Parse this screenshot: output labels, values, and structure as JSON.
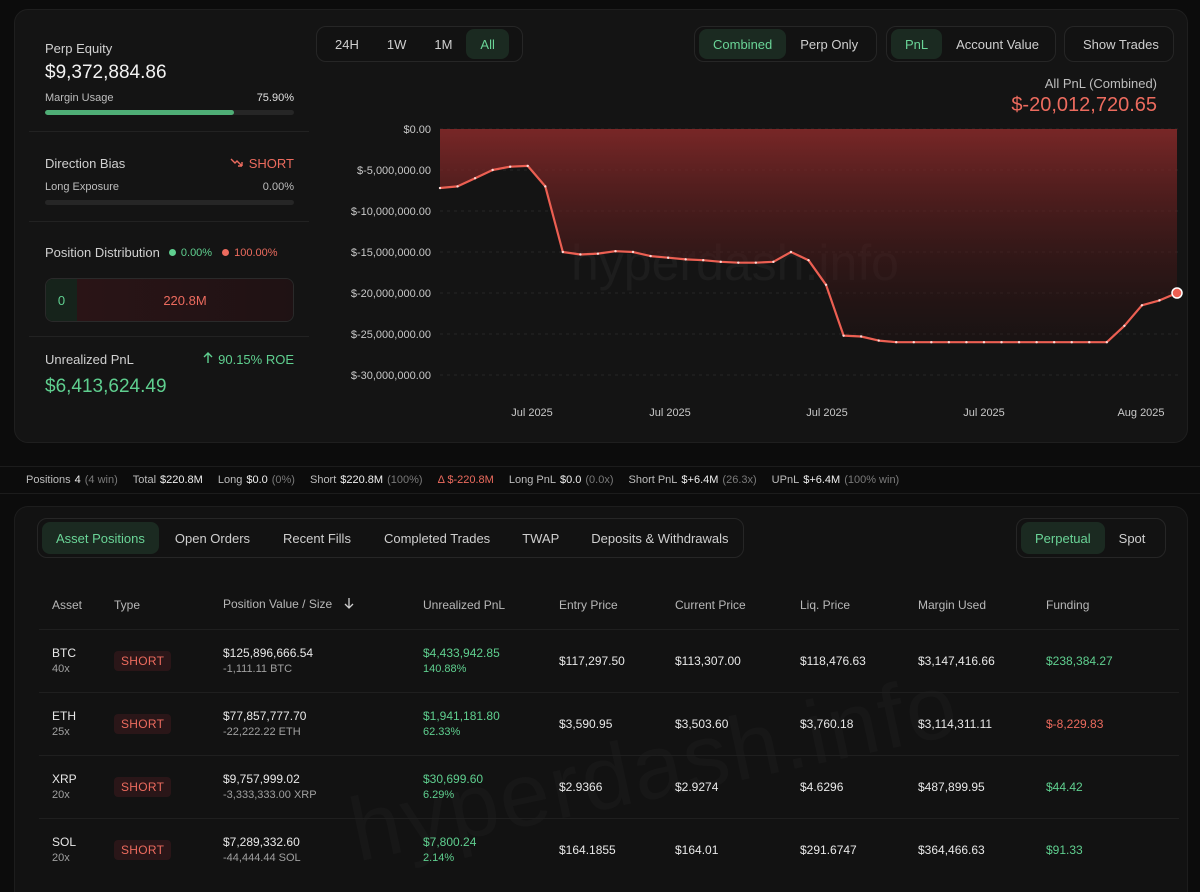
{
  "left": {
    "perp_equity_label": "Perp Equity",
    "perp_equity_value": "$9,372,884.86",
    "margin_usage_label": "Margin Usage",
    "margin_usage_value": "75.90%",
    "margin_usage_fraction": 0.759,
    "direction_bias_label": "Direction Bias",
    "direction_bias_value": "SHORT",
    "long_exposure_label": "Long Exposure",
    "long_exposure_value": "0.00%",
    "position_distribution_label": "Position Distribution",
    "dist_long_pct": "0.00%",
    "dist_short_pct": "100.00%",
    "dist_long_value": "0",
    "dist_short_value": "220.8M",
    "unrealized_pnl_label": "Unrealized PnL",
    "roe_value": "90.15% ROE",
    "unrealized_pnl_value": "$6,413,624.49"
  },
  "controls": {
    "time_ranges": [
      "24H",
      "1W",
      "1M",
      "All"
    ],
    "time_active": "All",
    "mode_options": [
      "Combined",
      "Perp Only"
    ],
    "mode_active": "Combined",
    "metric_options": [
      "PnL",
      "Account Value"
    ],
    "metric_active": "PnL",
    "show_trades_label": "Show Trades"
  },
  "chart_header": {
    "title": "All PnL (Combined)",
    "value": "$-20,012,720.65"
  },
  "watermark": "hyperdash.info",
  "chart_data": {
    "type": "area",
    "y_ticks": [
      "$0.00",
      "$-5,000,000.00",
      "$-10,000,000.00",
      "$-15,000,000.00",
      "$-20,000,000.00",
      "$-25,000,000.00",
      "$-30,000,000.00"
    ],
    "x_ticks": [
      "Jul 2025",
      "Jul 2025",
      "Jul 2025",
      "Jul 2025",
      "Aug 2025"
    ],
    "ylim": [
      -30000000,
      0
    ],
    "series": [
      {
        "values": [
          -7200000,
          -7000000,
          -6000000,
          -5000000,
          -4600000,
          -4500000,
          -7000000,
          -15000000,
          -15300000,
          -15200000,
          -14900000,
          -15000000,
          -15500000,
          -15700000,
          -15900000,
          -16000000,
          -16200000,
          -16300000,
          -16300000,
          -16200000,
          -15000000,
          -16000000,
          -19000000,
          -25200000,
          -25300000,
          -25800000,
          -26000000,
          -26000000,
          -26000000,
          -26000000,
          -26000000,
          -26000000,
          -26000000,
          -26000000,
          -26000000,
          -26000000,
          -26000000,
          -26000000,
          -26000000,
          -24000000,
          -21500000,
          -20900000,
          -20000000
        ]
      }
    ],
    "grid": true,
    "color": "#ec5f52"
  },
  "summary": {
    "positions_label": "Positions",
    "positions_value": "4",
    "positions_note": "(4 win)",
    "total_label": "Total",
    "total_value": "$220.8M",
    "long_label": "Long",
    "long_value": "$0.0",
    "long_note": "(0%)",
    "short_label": "Short",
    "short_value": "$220.8M",
    "short_note": "(100%)",
    "delta_value": "Δ $-220.8M",
    "long_pnl_label": "Long PnL",
    "long_pnl_value": "$0.0",
    "long_pnl_note": "(0.0x)",
    "short_pnl_label": "Short PnL",
    "short_pnl_value": "$+6.4M",
    "short_pnl_note": "(26.3x)",
    "upnl_label": "UPnL",
    "upnl_value": "$+6.4M",
    "upnl_note": "(100% win)"
  },
  "tabs": [
    "Asset Positions",
    "Open Orders",
    "Recent Fills",
    "Completed Trades",
    "TWAP",
    "Deposits & Withdrawals"
  ],
  "tab_active": "Asset Positions",
  "market_tabs": [
    "Perpetual",
    "Spot"
  ],
  "market_active": "Perpetual",
  "table": {
    "headers": [
      "Asset",
      "Type",
      "Position Value / Size",
      "Unrealized PnL",
      "Entry Price",
      "Current Price",
      "Liq. Price",
      "Margin Used",
      "Funding"
    ],
    "rows": [
      {
        "asset": "BTC",
        "leverage": "40x",
        "type": "SHORT",
        "value": "$125,896,666.54",
        "size": "-1,111.11 BTC",
        "upnl": "$4,433,942.85",
        "upnl_pct": "140.88%",
        "entry": "$117,297.50",
        "current": "$113,307.00",
        "liq": "$118,476.63",
        "margin": "$3,147,416.66",
        "funding": "$238,384.27",
        "funding_sign": "pos"
      },
      {
        "asset": "ETH",
        "leverage": "25x",
        "type": "SHORT",
        "value": "$77,857,777.70",
        "size": "-22,222.22 ETH",
        "upnl": "$1,941,181.80",
        "upnl_pct": "62.33%",
        "entry": "$3,590.95",
        "current": "$3,503.60",
        "liq": "$3,760.18",
        "margin": "$3,114,311.11",
        "funding": "$-8,229.83",
        "funding_sign": "neg"
      },
      {
        "asset": "XRP",
        "leverage": "20x",
        "type": "SHORT",
        "value": "$9,757,999.02",
        "size": "-3,333,333.00 XRP",
        "upnl": "$30,699.60",
        "upnl_pct": "6.29%",
        "entry": "$2.9366",
        "current": "$2.9274",
        "liq": "$4.6296",
        "margin": "$487,899.95",
        "funding": "$44.42",
        "funding_sign": "pos"
      },
      {
        "asset": "SOL",
        "leverage": "20x",
        "type": "SHORT",
        "value": "$7,289,332.60",
        "size": "-44,444.44 SOL",
        "upnl": "$7,800.24",
        "upnl_pct": "2.14%",
        "entry": "$164.1855",
        "current": "$164.01",
        "liq": "$291.6747",
        "margin": "$364,466.63",
        "funding": "$91.33",
        "funding_sign": "pos"
      }
    ]
  }
}
